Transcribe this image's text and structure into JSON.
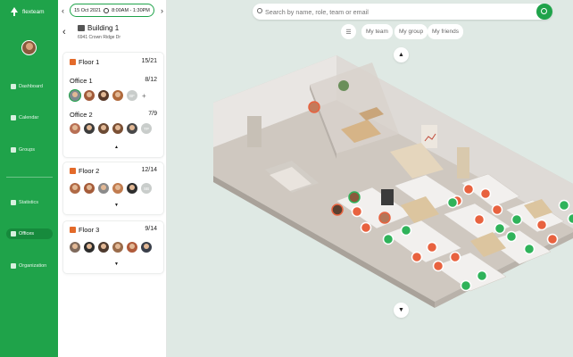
{
  "app": {
    "name": "flexteam"
  },
  "nav": {
    "items": [
      {
        "label": "Dashboard",
        "icon": "dashboard-icon"
      },
      {
        "label": "Calendar",
        "icon": "calendar-icon"
      },
      {
        "label": "Groups",
        "icon": "groups-icon"
      },
      {
        "label": "Statistics",
        "icon": "statistics-icon"
      },
      {
        "label": "Offices",
        "icon": "offices-icon",
        "active": true
      },
      {
        "label": "Organization",
        "icon": "organization-icon"
      }
    ]
  },
  "date_bar": {
    "date": "15 Oct 2021",
    "time": "8:00AM - 1:30PM"
  },
  "building": {
    "name": "Building 1",
    "address": "6941 Crown Ridge Dr"
  },
  "floors": [
    {
      "name": "Floor 1",
      "count": "15/21",
      "offices": [
        {
          "name": "Office 1",
          "count": "8/12",
          "extra_initials": "BF"
        },
        {
          "name": "Office 2",
          "count": "7/9",
          "extra_initials": "TP"
        }
      ]
    },
    {
      "name": "Floor 2",
      "count": "12/14",
      "extra_initials": "SB"
    },
    {
      "name": "Floor 3",
      "count": "9/14"
    }
  ],
  "search": {
    "placeholder": "Search by name, role, team or email"
  },
  "filters": [
    "My team",
    "My group",
    "My friends"
  ],
  "colors": {
    "brand": "#1fa34a",
    "occupied": "#e8623f",
    "available": "#2fb35a"
  }
}
